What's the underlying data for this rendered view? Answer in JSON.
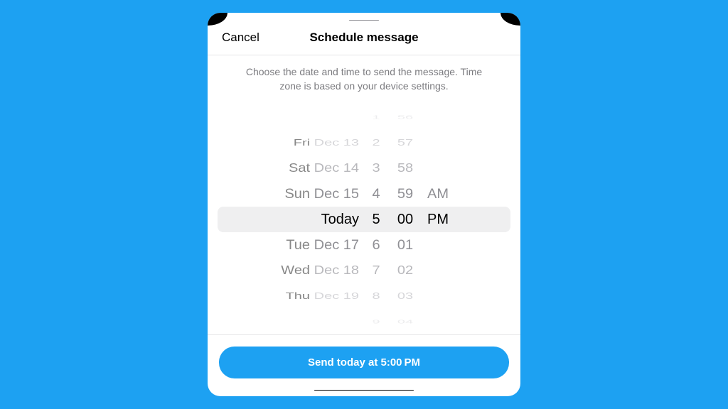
{
  "header": {
    "cancel": "Cancel",
    "title": "Schedule message"
  },
  "description": "Choose the date and time to send the message. Time zone is based on your device settings.",
  "picker": {
    "dates": {
      "m4": "",
      "m3_dow": "Fri",
      "m3_md": "Dec 13",
      "m2_dow": "Sat",
      "m2_md": "Dec 14",
      "m1_dow": "Sun",
      "m1_md": "Dec 15",
      "sel": "Today",
      "p1_dow": "Tue",
      "p1_md": "Dec 17",
      "p2_dow": "Wed",
      "p2_md": "Dec 18",
      "p3_dow": "Thu",
      "p3_md": "Dec 19",
      "p4": ""
    },
    "hours": {
      "m4": "1",
      "m3": "2",
      "m2": "3",
      "m1": "4",
      "sel": "5",
      "p1": "6",
      "p2": "7",
      "p3": "8",
      "p4": "9"
    },
    "minutes": {
      "m4": "56",
      "m3": "57",
      "m2": "58",
      "m1": "59",
      "sel": "00",
      "p1": "01",
      "p2": "02",
      "p3": "03",
      "p4": "04"
    },
    "ampm": {
      "m1": "AM",
      "sel": "PM"
    }
  },
  "footer": {
    "send": "Send today at 5:00 PM"
  }
}
